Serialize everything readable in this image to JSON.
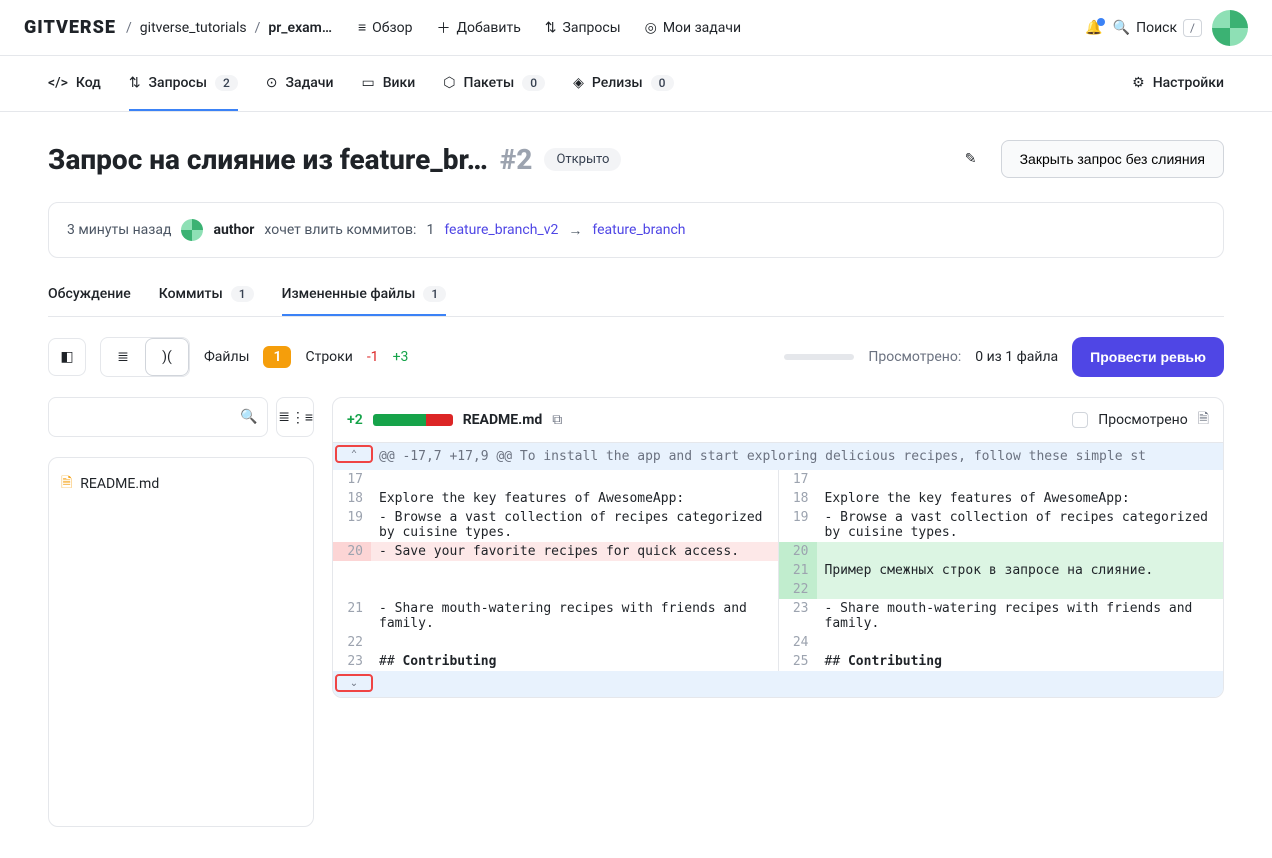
{
  "top": {
    "logo": "GITVERSE",
    "breadcrumb": {
      "org": "gitverse_tutorials",
      "repo": "pr_exam…"
    },
    "nav": {
      "overview": "Обзор",
      "add": "Добавить",
      "requests": "Запросы",
      "tasks": "Мои задачи",
      "search": "Поиск",
      "search_kbd": "/"
    }
  },
  "repoTabs": {
    "code": "Код",
    "requests": "Запросы",
    "requests_count": "2",
    "issues": "Задачи",
    "wiki": "Вики",
    "packages": "Пакеты",
    "packages_count": "0",
    "releases": "Релизы",
    "releases_count": "0",
    "settings": "Настройки"
  },
  "pr": {
    "title": "Запрос на слияние из feature_br…",
    "number": "#2",
    "status": "Открыто",
    "close_label": "Закрыть запрос без слияния",
    "info": {
      "time": "3 минуты назад",
      "author": "author",
      "text1": "хочет влить коммитов:",
      "count": "1",
      "from": "feature_branch_v2",
      "to": "feature_branch"
    }
  },
  "prTabs": {
    "discussion": "Обсуждение",
    "commits": "Коммиты",
    "commits_count": "1",
    "files": "Измененные файлы",
    "files_count": "1"
  },
  "toolbar": {
    "files_label": "Файлы",
    "files_count": "1",
    "lines_label": "Строки",
    "lines_del": "-1",
    "lines_add": "+3",
    "viewed": "Просмотрено:",
    "viewed_count": "0 из 1 файла",
    "review": "Провести ревью"
  },
  "fileTree": {
    "file": "README.md"
  },
  "diff": {
    "stat": "+2",
    "filename": "README.md",
    "viewed_label": "Просмотрено",
    "hunk": "@@ -17,7 +17,9 @@ To install the app and start exploring delicious recipes, follow these simple st",
    "left": [
      {
        "n": "17",
        "t": "ctx",
        "c": ""
      },
      {
        "n": "18",
        "t": "ctx",
        "c": "Explore the key features of AwesomeApp:"
      },
      {
        "n": "19",
        "t": "ctx",
        "c": "- Browse a vast collection of recipes categorized by cuisine types."
      },
      {
        "n": "20",
        "t": "del",
        "c": "- Save your favorite recipes for quick access."
      },
      {
        "n": "",
        "t": "empty",
        "c": ""
      },
      {
        "n": "",
        "t": "empty",
        "c": ""
      },
      {
        "n": "21",
        "t": "ctx",
        "c": "- Share mouth-watering recipes with friends and family."
      },
      {
        "n": "22",
        "t": "ctx",
        "c": ""
      },
      {
        "n": "23",
        "t": "ctx",
        "c": "## Contributing"
      }
    ],
    "right": [
      {
        "n": "17",
        "t": "ctx",
        "c": ""
      },
      {
        "n": "18",
        "t": "ctx",
        "c": "Explore the key features of AwesomeApp:"
      },
      {
        "n": "19",
        "t": "ctx",
        "c": "- Browse a vast collection of recipes categorized by cuisine types."
      },
      {
        "n": "20",
        "t": "add",
        "c": ""
      },
      {
        "n": "21",
        "t": "add",
        "c": "Пример смежных строк в запросе на слияние."
      },
      {
        "n": "22",
        "t": "add",
        "c": ""
      },
      {
        "n": "23",
        "t": "ctx",
        "c": "- Share mouth-watering recipes with friends and family."
      },
      {
        "n": "24",
        "t": "ctx",
        "c": ""
      },
      {
        "n": "25",
        "t": "ctx",
        "c": "## Contributing"
      }
    ]
  }
}
